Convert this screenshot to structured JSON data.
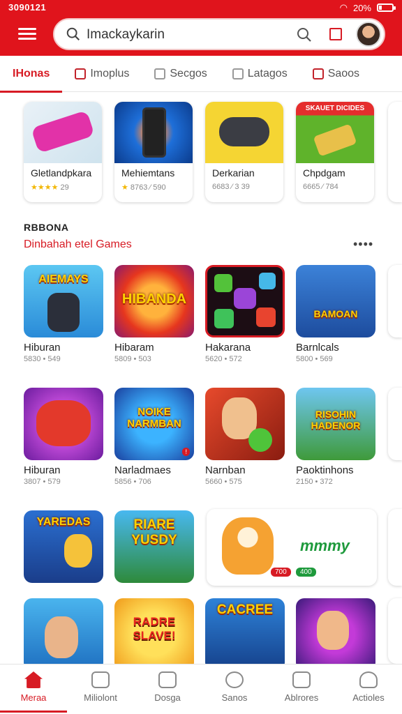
{
  "status": {
    "time": "3090121",
    "battery": "20%",
    "battery_level": 0.2
  },
  "search": {
    "placeholder": "Imackaykarin",
    "value": "Imackaykarin"
  },
  "tabs": [
    {
      "label": "IHonas",
      "active": true
    },
    {
      "label": "Imoplus"
    },
    {
      "label": "Secgos"
    },
    {
      "label": "Latagos"
    },
    {
      "label": "Saoos"
    }
  ],
  "featured": [
    {
      "name": "Gletlandpkara",
      "meta": "29",
      "stars": "★★★★",
      "icon": "controller-pink"
    },
    {
      "name": "Mehiemtans",
      "meta": "8763 ⁄ 590",
      "stars": "★",
      "icon": "phone-game"
    },
    {
      "name": "Derkarian",
      "meta": "6683 ⁄ 3 39",
      "icon": "gamepad"
    },
    {
      "name": "Chpdgam",
      "meta": "6665 ⁄ 784",
      "icon": "battery-game",
      "banner": "SKAUET DICIDES"
    }
  ],
  "section": {
    "label": "RBBONA",
    "title": "Dinbahah etel Games",
    "more": "••••"
  },
  "games_row1": [
    {
      "name": "Hiburan",
      "meta": "5830 • 549",
      "art": "AIEMAYS"
    },
    {
      "name": "Hibaram",
      "meta": "5809 • 503",
      "art": "HIBANDA"
    },
    {
      "name": "Hakarana",
      "meta": "5620 • 572",
      "art": ""
    },
    {
      "name": "Barnlcals",
      "meta": "5800 • 569",
      "art": "BAMOAN"
    }
  ],
  "games_row2": [
    {
      "name": "Hiburan",
      "meta": "3807 • 579",
      "art": ""
    },
    {
      "name": "Narladmaes",
      "meta": "5856 • 706",
      "art": "NOIKE NARMBAN"
    },
    {
      "name": "Narnban",
      "meta": "5660 • 575",
      "art": ""
    },
    {
      "name": "Paoktinhons",
      "meta": "2150 • 372",
      "art": "RISOHIN HADENOR"
    }
  ],
  "games_row3": [
    {
      "art": "YAREDAS"
    },
    {
      "art": "RIARE YUSDY"
    }
  ],
  "wide_card": {
    "brand": "mmmy",
    "pill1": "700",
    "pill2": "400"
  },
  "games_row4": [
    {
      "art": ""
    },
    {
      "art": "RADRE SLAVE!"
    },
    {
      "art": "CACREE"
    },
    {
      "art": ""
    }
  ],
  "bottom_nav": [
    {
      "label": "Meraa",
      "active": true
    },
    {
      "label": "Miliolont"
    },
    {
      "label": "Dosga"
    },
    {
      "label": "Sanos"
    },
    {
      "label": "Ablrores"
    },
    {
      "label": "Actioles"
    }
  ]
}
